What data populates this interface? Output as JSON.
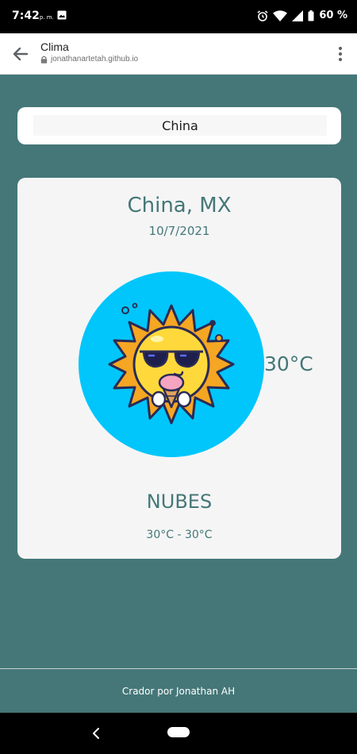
{
  "status_bar": {
    "time": "7:42",
    "ampm": "p. m.",
    "battery": "60 %"
  },
  "browser": {
    "title": "Clima",
    "url": "jonathanartetah.github.io"
  },
  "search": {
    "value": "China"
  },
  "weather": {
    "location": "China, MX",
    "date": "10/7/2021",
    "temperature": "30°C",
    "condition": "NUBES",
    "range": "30°C - 30°C",
    "circle_color": "#00c6fb"
  },
  "footer": {
    "credit": "Crador por Jonathan AH"
  },
  "theme": {
    "background": "#457778",
    "card": "#f5f5f5"
  }
}
